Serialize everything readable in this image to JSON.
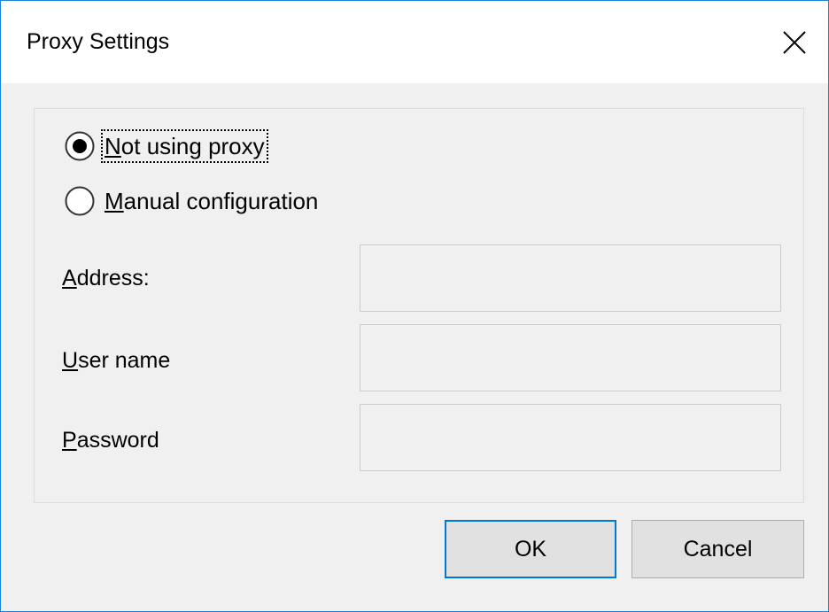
{
  "window": {
    "title": "Proxy Settings"
  },
  "proxy_mode": {
    "options": [
      {
        "mnemonic": "N",
        "rest": "ot using proxy",
        "selected": true
      },
      {
        "mnemonic": "M",
        "rest": "anual configuration",
        "selected": false
      }
    ]
  },
  "fields": {
    "address": {
      "mnemonic": "A",
      "rest": "ddress:",
      "value": ""
    },
    "username": {
      "mnemonic": "U",
      "rest": "ser name",
      "value": ""
    },
    "password": {
      "mnemonic": "P",
      "rest": "assword",
      "value": ""
    }
  },
  "buttons": {
    "ok_label": "OK",
    "cancel_label": "Cancel"
  },
  "colors": {
    "window_border": "#1883d7",
    "default_button_border": "#0078d7",
    "dialog_background": "#f0f0f0"
  }
}
